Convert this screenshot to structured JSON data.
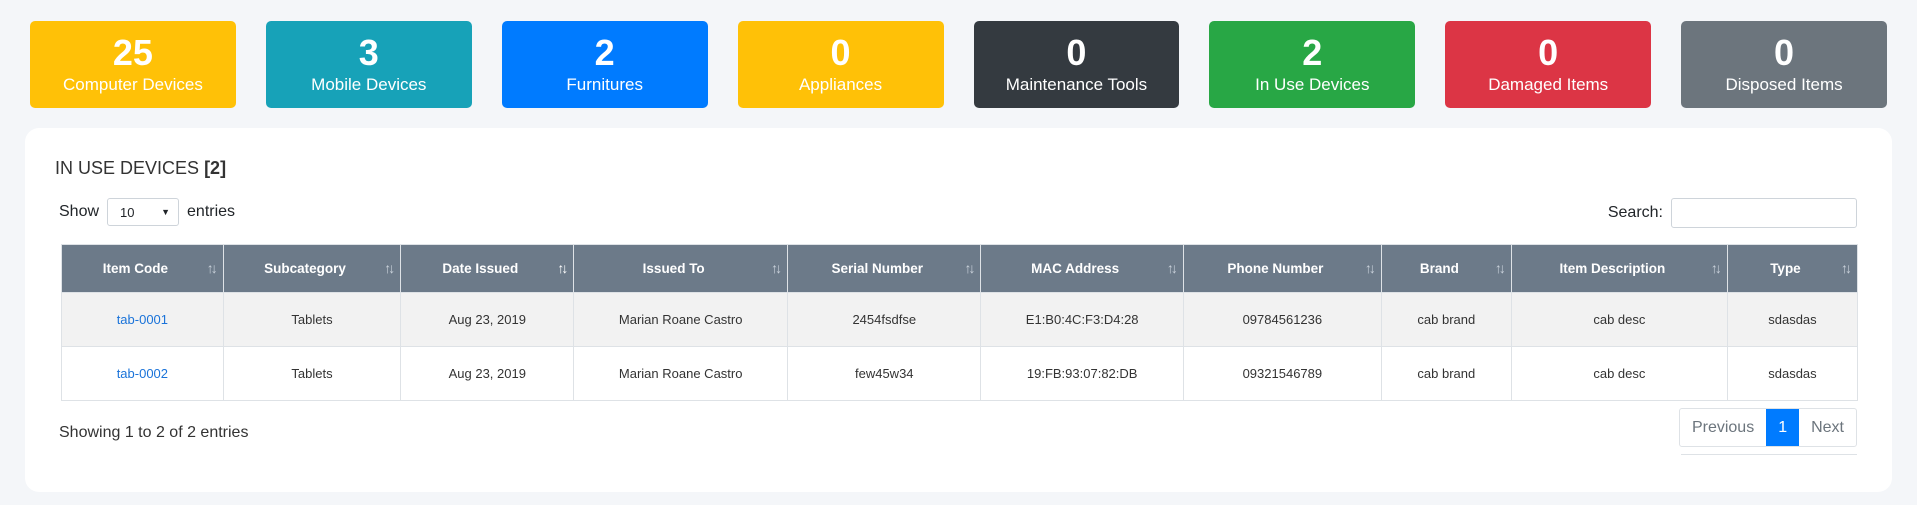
{
  "stats": [
    {
      "count": "25",
      "label": "Computer Devices",
      "color": "#ffc107"
    },
    {
      "count": "3",
      "label": "Mobile Devices",
      "color": "#17a2b8"
    },
    {
      "count": "2",
      "label": "Furnitures",
      "color": "#007bff"
    },
    {
      "count": "0",
      "label": "Appliances",
      "color": "#ffc107"
    },
    {
      "count": "0",
      "label": "Maintenance Tools",
      "color": "#343a40"
    },
    {
      "count": "2",
      "label": "In Use Devices",
      "color": "#28a745"
    },
    {
      "count": "0",
      "label": "Damaged Items",
      "color": "#dc3545"
    },
    {
      "count": "0",
      "label": "Disposed Items",
      "color": "#6c757d"
    }
  ],
  "card": {
    "title": "IN USE DEVICES",
    "count_badge": "[2]"
  },
  "length": {
    "show": "Show",
    "value": "10",
    "entries": "entries"
  },
  "search": {
    "label": "Search:",
    "value": ""
  },
  "table": {
    "headers": [
      "Item Code",
      "Subcategory",
      "Date Issued",
      "Issued To",
      "Serial Number",
      "MAC Address",
      "Phone Number",
      "Brand",
      "Item Description",
      "Type"
    ],
    "rows": [
      [
        "tab-0001",
        "Tablets",
        "Aug 23, 2019",
        "Marian Roane Castro",
        "2454fsdfse",
        "E1:B0:4C:F3:D4:28",
        "09784561236",
        "cab brand",
        "cab desc",
        "sdasdas"
      ],
      [
        "tab-0002",
        "Tablets",
        "Aug 23, 2019",
        "Marian Roane Castro",
        "few45w34",
        "19:FB:93:07:82:DB",
        "09321546789",
        "cab brand",
        "cab desc",
        "sdasdas"
      ]
    ]
  },
  "info": "Showing 1 to 2 of 2 entries",
  "pagination": {
    "previous": "Previous",
    "current": "1",
    "next": "Next"
  }
}
